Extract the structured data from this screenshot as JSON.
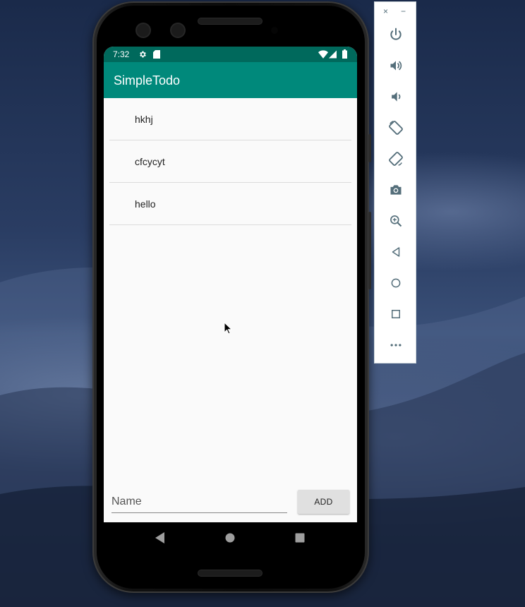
{
  "status_bar": {
    "time": "7:32",
    "left_icons": [
      "gear-icon",
      "sd-card-icon"
    ],
    "right_icons": [
      "wifi-icon",
      "signal-icon",
      "battery-icon"
    ]
  },
  "app": {
    "title": "SimpleTodo",
    "colors": {
      "primary": "#00897b",
      "primary_dark": "#00695c",
      "background": "#fafafa"
    }
  },
  "todo_list": {
    "items": [
      {
        "label": "hkhj"
      },
      {
        "label": "cfcycyt"
      },
      {
        "label": "hello"
      }
    ]
  },
  "input": {
    "placeholder": "Name",
    "value": ""
  },
  "add_button": {
    "label": "ADD"
  },
  "nav_bar": {
    "buttons": [
      "back-icon",
      "home-icon",
      "recents-icon"
    ]
  },
  "emulator_toolbar": {
    "window_controls": [
      "close-icon",
      "minimize-icon"
    ],
    "tools": [
      {
        "name": "power-icon"
      },
      {
        "name": "volume-up-icon"
      },
      {
        "name": "volume-down-icon"
      },
      {
        "name": "rotate-left-icon"
      },
      {
        "name": "rotate-right-icon"
      },
      {
        "name": "camera-icon"
      },
      {
        "name": "zoom-icon"
      },
      {
        "name": "back-icon"
      },
      {
        "name": "home-icon"
      },
      {
        "name": "overview-icon"
      },
      {
        "name": "more-icon"
      }
    ],
    "window_control_glyphs": {
      "close": "×",
      "minimize": "−"
    },
    "icon_color": "#546e7a"
  }
}
